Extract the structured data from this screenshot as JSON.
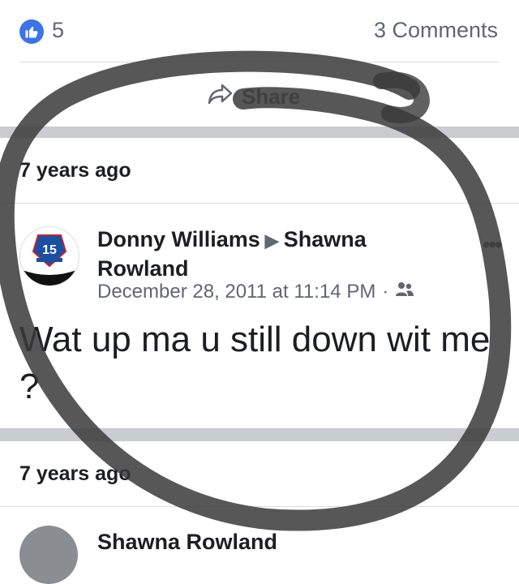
{
  "reactions": {
    "like_count": "5",
    "comments": "3 Comments"
  },
  "share": {
    "label": "Share"
  },
  "posts": [
    {
      "time_header": "7 years ago",
      "author": "Donny Williams",
      "recipient": "Shawna Rowland",
      "date": "December 28, 2011 at 11:14 PM",
      "separator": "·",
      "audience_icon": "friends-icon",
      "text": "Wat up ma u still down wit me ?",
      "avatar_badge": "15"
    },
    {
      "time_header": "7 years ago",
      "author": "Shawna Rowland"
    }
  ],
  "colors": {
    "like_blue": "#3b73e8",
    "secondary_text": "#606770",
    "separator_gray": "#c9ccd1",
    "marker_stroke": "#3a3a3a"
  }
}
